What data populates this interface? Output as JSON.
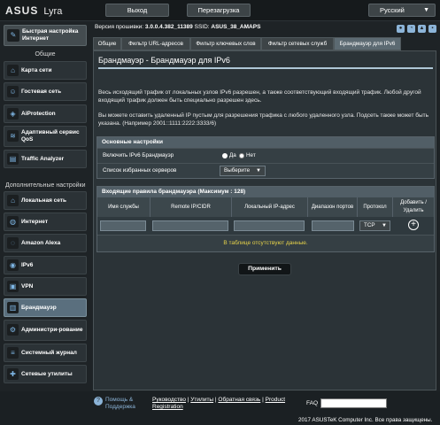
{
  "topbar": {
    "logo": "ASUS",
    "model": "Lyra",
    "logout_label": "Выход",
    "reboot_label": "Перезагрузка",
    "language": "Русский"
  },
  "header": {
    "firmware_label": "Версия прошивки:",
    "firmware_value": "3.0.0.4.382_11389",
    "ssid_label": "SSID:",
    "ssid_value": "ASUS_38_AMAPS"
  },
  "sidebar": {
    "quick_setup": "Быстрая настройка Интернет",
    "general_header": "Общие",
    "general_items": [
      "Карта сети",
      "Гостевая сеть",
      "AiProtection",
      "Адаптивный сервис QoS",
      "Traffic Analyzer"
    ],
    "advanced_header": "Дополнительные настройки",
    "advanced_items": [
      "Локальная сеть",
      "Интернет",
      "Amazon Alexa",
      "IPv6",
      "VPN",
      "Брандмауэр",
      "Администри-рование",
      "Системный журнал",
      "Сетевые утилиты"
    ]
  },
  "tabs": [
    "Общие",
    "Фильтр URL-адресов",
    "Фильтр ключевых слов",
    "Фильтр сетевых служб",
    "Брандмауэр для IPv6"
  ],
  "panel": {
    "title": "Брандмауэр - Брандмауэр для IPv6",
    "desc1": "Весь исходящий трафик от локальных узлов IPv6 разрешен, а также соответствующий входящий трафик. Любой другой входящий трафик должен быть специально разрешен здесь.",
    "desc2": "Вы можете оставить удаленный IP пустым для разрешения трафика с любого удаленного узла. Подсеть также может быть указана. (Например 2001::1111:2222:3333/6)",
    "basic_header": "Основные настройки",
    "enable_label": "Включить IPv6 Брандмауэр",
    "yes_label": "Да",
    "no_label": "Нет",
    "favorites_label": "Список избранных серверов",
    "favorites_value": "Выберите",
    "rules_header": "Входящие правила брандмауэра (Максимум : 128)",
    "cols": [
      "Имя службы",
      "Remote IP/CIDR",
      "Локальный IP-адрес",
      "Диапазон портов",
      "Протокол",
      "Добавить / Удалить"
    ],
    "protocol_value": "TCP",
    "empty_text": "В таблице отсутствуют данные.",
    "apply_label": "Применить"
  },
  "footer": {
    "help_label": "Помощь & Поддержка",
    "links": [
      "Руководство",
      "Утилиты",
      "Обратная связь",
      "Product Registration"
    ],
    "faq": "FAQ",
    "copyright": "2017 ASUSTeK Computer Inc. Все права защищены."
  },
  "colors": {
    "accent": "#aec7d6",
    "empty_text": "#e6d24a",
    "active_item": "#5a6f7e"
  }
}
